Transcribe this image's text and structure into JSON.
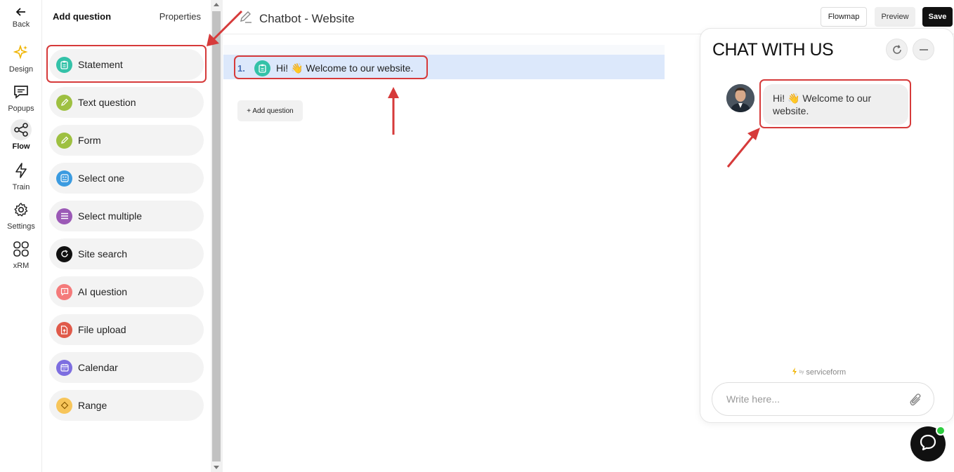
{
  "rail": {
    "back": "Back",
    "items": [
      {
        "label": "Design",
        "icon": "sparkles-icon"
      },
      {
        "label": "Popups",
        "icon": "message-icon"
      },
      {
        "label": "Flow",
        "icon": "share-nodes-icon"
      },
      {
        "label": "Train",
        "icon": "lightning-icon"
      },
      {
        "label": "Settings",
        "icon": "gear-icon"
      },
      {
        "label": "xRM",
        "icon": "grid-icon"
      }
    ]
  },
  "panel": {
    "tab_add": "Add question",
    "tab_properties": "Properties",
    "types": [
      {
        "label": "Statement",
        "color": "#34c2a8"
      },
      {
        "label": "Text question",
        "color": "#9ec041"
      },
      {
        "label": "Form",
        "color": "#9ec041"
      },
      {
        "label": "Select one",
        "color": "#3b9be0"
      },
      {
        "label": "Select multiple",
        "color": "#9b59b6"
      },
      {
        "label": "Site search",
        "color": "#111111"
      },
      {
        "label": "AI question",
        "color": "#f47a7a"
      },
      {
        "label": "File upload",
        "color": "#e05a4a"
      },
      {
        "label": "Calendar",
        "color": "#7d6ee0"
      },
      {
        "label": "Range",
        "color": "#f7c55a"
      }
    ]
  },
  "header": {
    "title": "Chatbot - Website",
    "flowmap": "Flowmap",
    "preview": "Preview",
    "save": "Save"
  },
  "canvas": {
    "question_number": "1.",
    "question_text": "Hi! 👋 Welcome to our website.",
    "add_question": "+ Add question"
  },
  "chat": {
    "title": "CHAT WITH US",
    "message": "Hi! 👋 Welcome to our website.",
    "branding_by": "by",
    "branding": "serviceform",
    "input_placeholder": "Write here..."
  },
  "colors": {
    "annotation": "#d63a3a",
    "accent": "#34c2a8",
    "selected_row": "#dce8fb"
  }
}
